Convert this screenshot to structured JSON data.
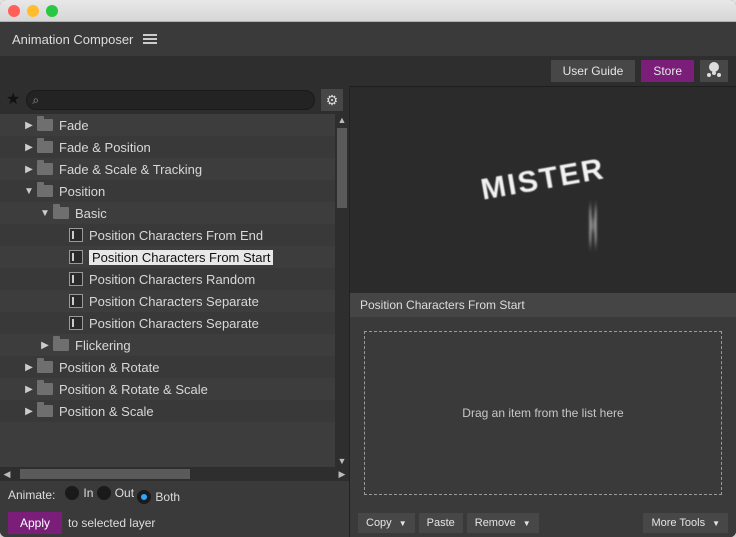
{
  "app": {
    "title": "Animation Composer"
  },
  "toolbar": {
    "user_guide": "User Guide",
    "store": "Store"
  },
  "search": {
    "placeholder": ""
  },
  "tree": {
    "items": [
      {
        "depth": 1,
        "kind": "folder",
        "expand": "closed",
        "label": "Fade"
      },
      {
        "depth": 1,
        "kind": "folder",
        "expand": "closed",
        "label": "Fade & Position"
      },
      {
        "depth": 1,
        "kind": "folder",
        "expand": "closed",
        "label": "Fade & Scale & Tracking"
      },
      {
        "depth": 1,
        "kind": "folder",
        "expand": "open",
        "label": "Position"
      },
      {
        "depth": 2,
        "kind": "folder",
        "expand": "open",
        "label": "Basic"
      },
      {
        "depth": 3,
        "kind": "preset",
        "expand": "none",
        "label": "Position Characters From End"
      },
      {
        "depth": 3,
        "kind": "preset",
        "expand": "none",
        "label": "Position Characters From Start",
        "selected": true
      },
      {
        "depth": 3,
        "kind": "preset",
        "expand": "none",
        "label": "Position Characters Random"
      },
      {
        "depth": 3,
        "kind": "preset",
        "expand": "none",
        "label": "Position Characters Separate"
      },
      {
        "depth": 3,
        "kind": "preset",
        "expand": "none",
        "label": "Position Characters Separate"
      },
      {
        "depth": 2,
        "kind": "folder",
        "expand": "closed",
        "label": "Flickering"
      },
      {
        "depth": 1,
        "kind": "folder",
        "expand": "closed",
        "label": "Position & Rotate"
      },
      {
        "depth": 1,
        "kind": "folder",
        "expand": "closed",
        "label": "Position & Rotate & Scale"
      },
      {
        "depth": 1,
        "kind": "folder",
        "expand": "closed",
        "label": "Position & Scale"
      }
    ]
  },
  "animate": {
    "label": "Animate:",
    "options": [
      {
        "label": "In",
        "on": false
      },
      {
        "label": "Out",
        "on": false
      },
      {
        "label": "Both",
        "on": true
      }
    ]
  },
  "apply": {
    "button": "Apply",
    "suffix": "to selected layer"
  },
  "preview": {
    "title": "Position Characters From Start",
    "mister": "MISTER",
    "h": "H"
  },
  "dropzone": {
    "text": "Drag an item from the list here"
  },
  "footer": {
    "copy": "Copy",
    "paste": "Paste",
    "remove": "Remove",
    "more_tools": "More Tools"
  }
}
